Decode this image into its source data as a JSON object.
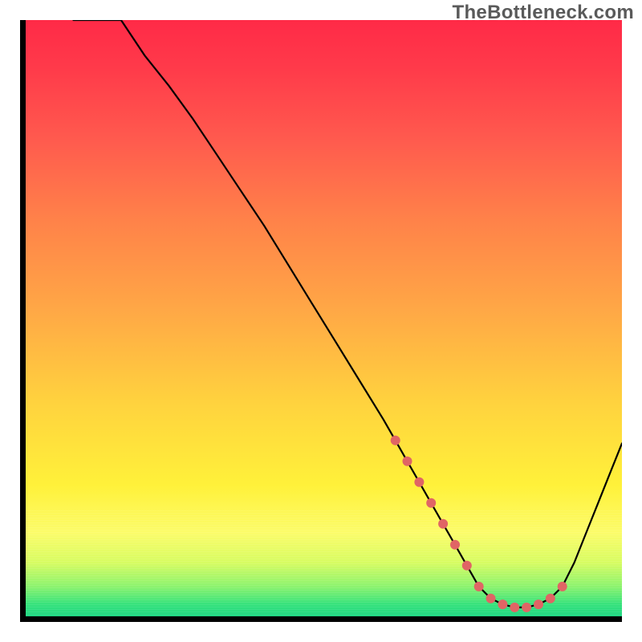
{
  "watermark": "TheBottleneck.com",
  "gradient_stops": [
    {
      "offset": 0,
      "color": "#ff2a47"
    },
    {
      "offset": 8,
      "color": "#ff3a4a"
    },
    {
      "offset": 20,
      "color": "#ff5a4e"
    },
    {
      "offset": 34,
      "color": "#ff8349"
    },
    {
      "offset": 48,
      "color": "#ffa646"
    },
    {
      "offset": 64,
      "color": "#ffd23e"
    },
    {
      "offset": 78,
      "color": "#fff13a"
    },
    {
      "offset": 86,
      "color": "#fcfc6a"
    },
    {
      "offset": 91,
      "color": "#d7fc62"
    },
    {
      "offset": 95,
      "color": "#8cf36e"
    },
    {
      "offset": 98,
      "color": "#36e27c"
    },
    {
      "offset": 100,
      "color": "#1fd782"
    }
  ],
  "marker_color": "#e06565",
  "curve_color": "#000000",
  "chart_data": {
    "type": "line",
    "title": "",
    "xlabel": "",
    "ylabel": "",
    "xlim": [
      0,
      100
    ],
    "ylim": [
      0,
      100
    ],
    "grid": false,
    "series": [
      {
        "name": "curve",
        "x": [
          0,
          4,
          8,
          12,
          16,
          20,
          24,
          28,
          32,
          36,
          40,
          44,
          48,
          52,
          56,
          60,
          62,
          64,
          66,
          68,
          70,
          72,
          74,
          76,
          78,
          80,
          82,
          84,
          86,
          88,
          90,
          92,
          94,
          96,
          98,
          100
        ],
        "y": [
          0,
          0,
          0,
          0,
          100,
          94,
          89,
          83.5,
          77.5,
          71.5,
          65.5,
          59,
          52.5,
          46,
          39.5,
          33,
          29.5,
          26,
          22.5,
          19,
          15.5,
          12,
          8.5,
          5,
          3,
          2,
          1.5,
          1.5,
          2,
          3,
          5,
          9,
          14,
          19,
          24,
          29
        ]
      }
    ],
    "markers": {
      "name": "highlight-markers",
      "x": [
        62,
        64,
        66,
        68,
        70,
        72,
        74,
        76,
        78,
        80,
        82,
        84,
        86,
        88,
        90
      ],
      "y": [
        29.5,
        26,
        22.5,
        19,
        15.5,
        12,
        8.5,
        5,
        3,
        2,
        1.5,
        1.5,
        2,
        3,
        5
      ]
    },
    "notes": "Axes are unlabeled in the source image; x 0-100 and y 0-100 are normalized estimates of the plotted curve read from pixel positions. Left portion of curve is clipped by the plot border; values shown as 0 where the line exits the top edge are placeholders."
  }
}
